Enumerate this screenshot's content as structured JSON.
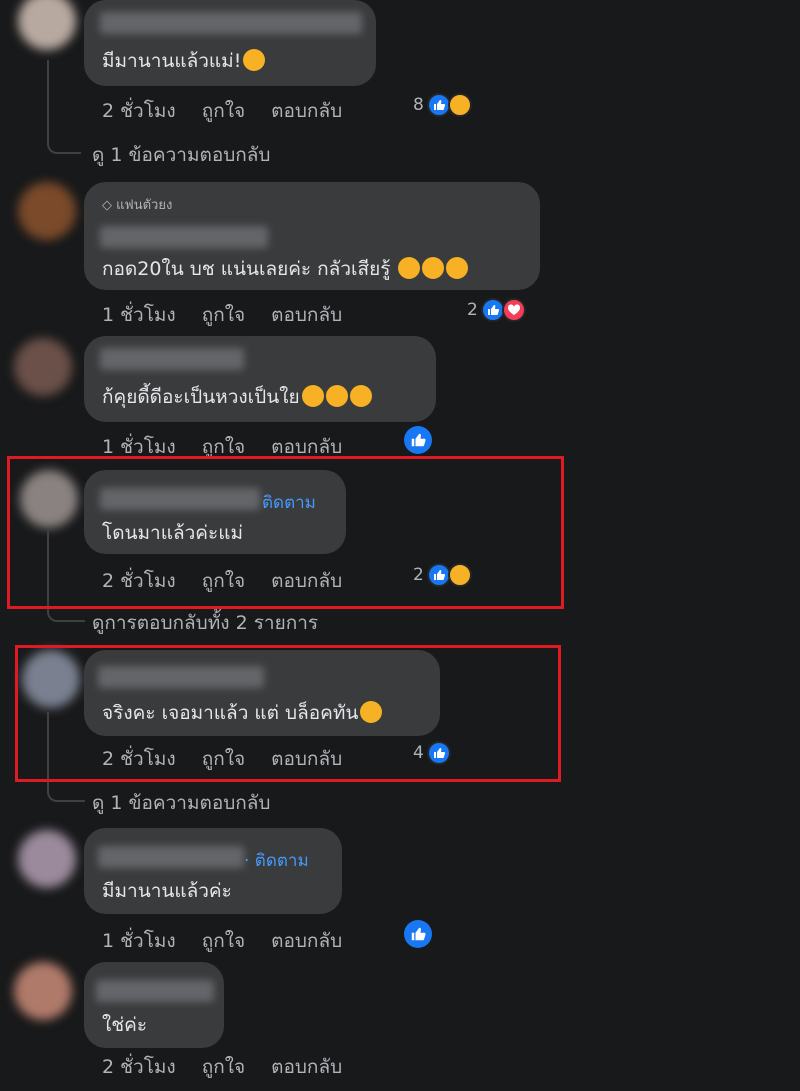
{
  "comments": [
    {
      "text": "มีมานานแล้วแม่!",
      "time": "2 ชั่วโมง",
      "reaction_count": "8",
      "reply_link": "ดู 1 ข้อความตอบกลับ"
    },
    {
      "badge": "แฟนตัวยง",
      "text": "กอด20ใน บช แน่นเลยค่ะ กลัวเสียรู้",
      "time": "1 ชั่วโมง",
      "reaction_count": "2"
    },
    {
      "text": "ก้คุยดี้ดีอะเป็นหวงเป็นใย",
      "time": "1 ชั่วโมง",
      "reaction_count": ""
    },
    {
      "follow": "ติดตาม",
      "text": "โดนมาแล้วค่ะแม่",
      "time": "2 ชั่วโมง",
      "reaction_count": "2",
      "reply_link": "ดูการตอบกลับทั้ง 2 รายการ"
    },
    {
      "text": "จริงคะ เจอมาแล้ว แต่ บล็อคทัน",
      "time": "2 ชั่วโมง",
      "reaction_count": "4",
      "reply_link": "ดู 1 ข้อความตอบกลับ"
    },
    {
      "follow": "· ติดตาม",
      "text": "มีมานานแล้วค่ะ",
      "time": "1 ชั่วโมง",
      "reaction_count": ""
    },
    {
      "text": "ใช่ค่ะ",
      "time": "2 ชั่วโมง",
      "reaction_count": ""
    }
  ],
  "actions": {
    "like": "ถูกใจ",
    "reply": "ตอบกลับ"
  },
  "colors": {
    "background": "#18191a",
    "bubble": "#3a3b3c",
    "link": "#4599ff",
    "like": "#1877f2",
    "highlight": "#e01a22"
  },
  "icons": [
    "like-reaction-icon",
    "heart-reaction-icon",
    "emoji-reaction-icon",
    "diamond-badge-icon"
  ]
}
